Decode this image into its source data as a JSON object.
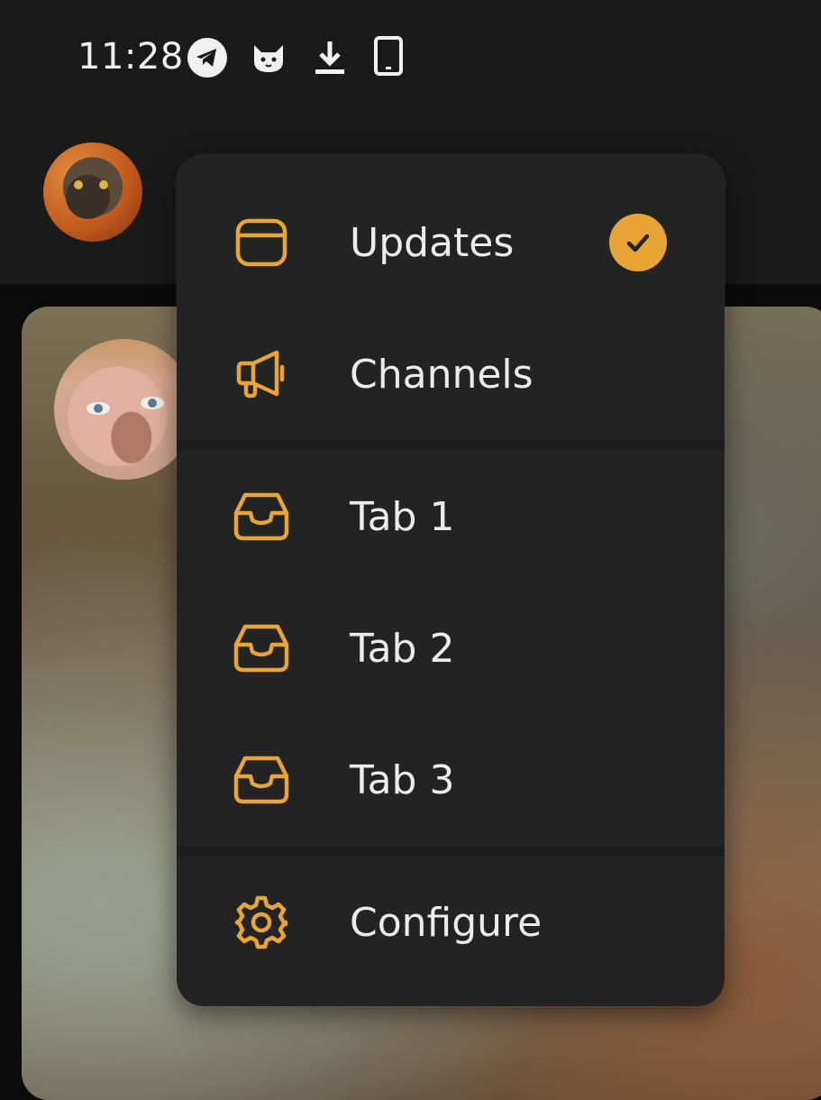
{
  "status_bar": {
    "time": "11:28",
    "icons": [
      "telegram-icon",
      "cat-icon",
      "download-icon",
      "phone-icon"
    ]
  },
  "menu": {
    "accent_color": "#e8a535",
    "items": [
      {
        "label": "Updates",
        "icon": "window-icon",
        "selected": true
      },
      {
        "label": "Channels",
        "icon": "megaphone-icon",
        "selected": false
      },
      {
        "label": "Tab 1",
        "icon": "inbox-icon",
        "selected": false
      },
      {
        "label": "Tab 2",
        "icon": "inbox-icon",
        "selected": false
      },
      {
        "label": "Tab 3",
        "icon": "inbox-icon",
        "selected": false
      },
      {
        "label": "Configure",
        "icon": "gear-icon",
        "selected": false
      }
    ]
  }
}
